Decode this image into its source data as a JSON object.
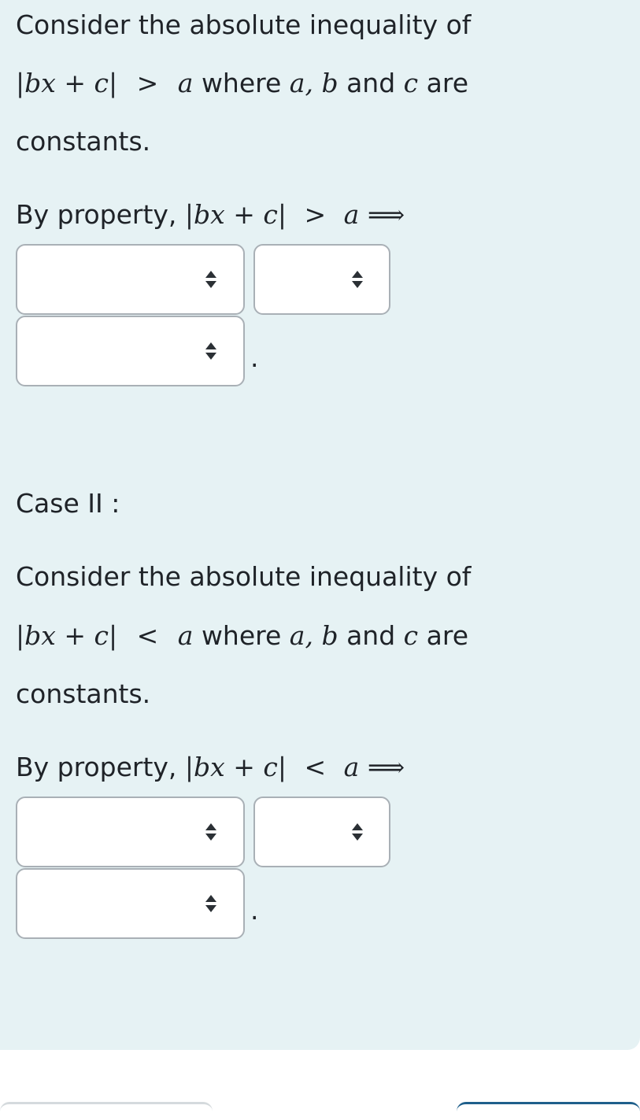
{
  "case1": {
    "intro_text": "Consider the absolute inequality of",
    "expr_abs": "|bx + c|",
    "relation": ">",
    "rhs": "a",
    "where_text": "where",
    "vars": "a, b",
    "and_text": "and",
    "var_c": "c",
    "are_text": "are",
    "constants_text": "constants.",
    "property_prefix": "By property,",
    "implies": "⟹",
    "period": ".",
    "selects": [
      {
        "value": ""
      },
      {
        "value": ""
      },
      {
        "value": ""
      }
    ]
  },
  "case2": {
    "heading": "Case II :",
    "intro_text": "Consider the absolute inequality of",
    "expr_abs": "|bx + c|",
    "relation": "<",
    "rhs": "a",
    "where_text": "where",
    "vars": "a, b",
    "and_text": "and",
    "var_c": "c",
    "are_text": "are",
    "constants_text": "constants.",
    "property_prefix": "By property,",
    "implies": "⟹",
    "period": ".",
    "selects": [
      {
        "value": ""
      },
      {
        "value": ""
      },
      {
        "value": ""
      }
    ]
  },
  "icons": {
    "select_arrows": "up-down-caret-icon"
  },
  "colors": {
    "panel_bg": "#e6f2f4",
    "select_border": "#a9b0b6",
    "text": "#1f2328"
  }
}
